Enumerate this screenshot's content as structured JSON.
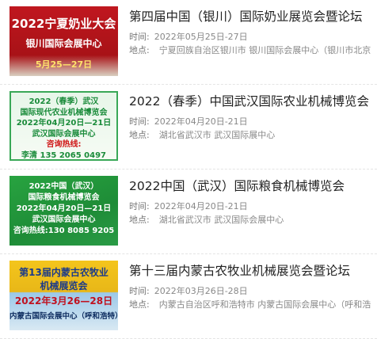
{
  "expos": [
    {
      "poster": [
        "2022宁夏奶业大会",
        "银川国际会展中心",
        "5月25—27日"
      ],
      "title": "第四届中国（银川）国际奶业展览会暨论坛",
      "time_label": "时间:",
      "time": "2022年05月25日-27日",
      "place_label": "地点:",
      "place": "宁夏回族自治区银川市 银川国际会展中心（银川市北京"
    },
    {
      "poster": [
        "2022（春季）武汉",
        "国际现代农业机械博览会",
        "2022年04月20日—21日",
        "武汉国际会展中心",
        "咨询热线:",
        "李清 135 2065 0497"
      ],
      "title": "2022（春季）中国武汉国际农业机械博览会",
      "time_label": "时间:",
      "time": "2022年04月20日-21日",
      "place_label": "地点:",
      "place": "湖北省武汉市 武汉国际展中心"
    },
    {
      "poster": [
        "2022中国（武汉）",
        "国际粮食机械博览会",
        "2022年04月20日—21日",
        "武汉国际会展中心",
        "咨询热线:130 8085 9205"
      ],
      "title": "2022中国（武汉）国际粮食机械博览会",
      "time_label": "时间:",
      "time": "2022年04月20日-21日",
      "place_label": "地点:",
      "place": "湖北省武汉市 武汉国际会展中心"
    },
    {
      "poster": [
        "第13届内蒙古农牧业",
        "机械展览会",
        "2022年3月26—28日",
        "内蒙古国际会展中心（呼和浩特）"
      ],
      "title": "第十三届内蒙古农牧业机械展览会暨论坛",
      "time_label": "时间:",
      "time": "2022年03月26日-28日",
      "place_label": "地点:",
      "place": "内蒙古自治区呼和浩特市 内蒙古国际会展中心（呼和浩"
    }
  ]
}
